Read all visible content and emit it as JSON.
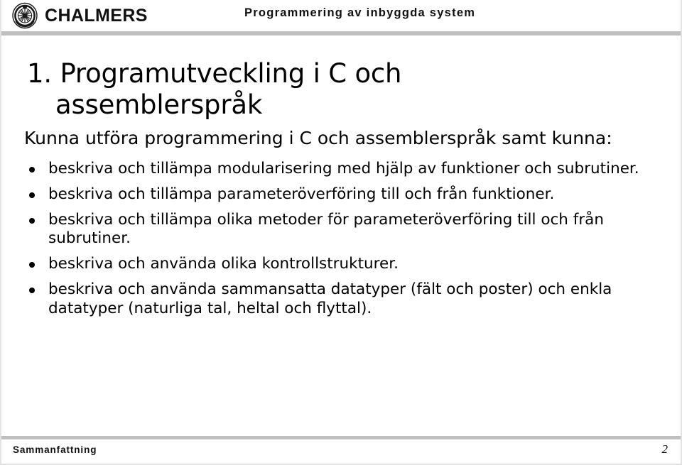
{
  "header": {
    "logo_icon": "chalmers-crest-icon",
    "logo_text": "CHALMERS",
    "course_title": "Programmering av inbyggda system"
  },
  "slide": {
    "title_line1": "1. Programutveckling i C och",
    "title_line2": "assemblerspråk",
    "subtitle": "Kunna utföra programmering i C och assemblerspråk samt kunna:",
    "bullets": [
      "beskriva och tillämpa modularisering med hjälp av funktioner och subrutiner.",
      "beskriva och tillämpa parameteröverföring till och från funktioner.",
      "beskriva och tillämpa olika metoder för parameteröverföring till och från subrutiner.",
      "beskriva och använda olika kontrollstrukturer.",
      "beskriva och använda sammansatta datatyper (fält och poster) och enkla datatyper (naturliga tal, heltal och flyttal)."
    ]
  },
  "footer": {
    "section_label": "Sammanfattning",
    "page_number": "2"
  },
  "colors": {
    "rule": "#bfbfbf",
    "text": "#000000",
    "page_background": "#ffffff"
  }
}
